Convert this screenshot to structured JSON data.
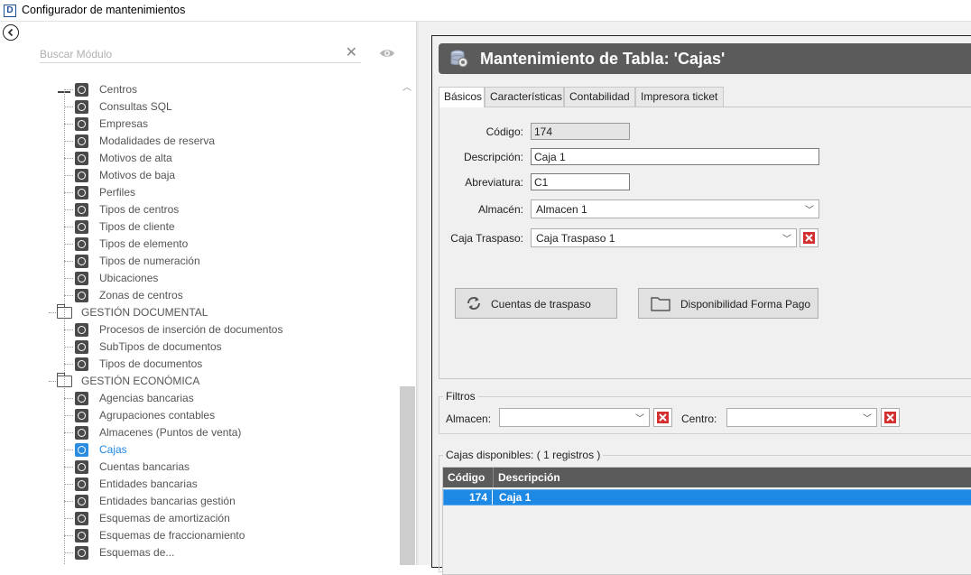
{
  "window": {
    "app_icon": "D",
    "title": "Configurador de mantenimientos"
  },
  "left_panel": {
    "back_icon": "back-arrow-icon",
    "search": {
      "placeholder": "Buscar Módulo",
      "value": "",
      "clear_glyph": "✕"
    },
    "tree": [
      {
        "type": "leaf",
        "label": "Centros"
      },
      {
        "type": "leaf",
        "label": "Consultas SQL"
      },
      {
        "type": "leaf",
        "label": "Empresas"
      },
      {
        "type": "leaf",
        "label": "Modalidades de reserva"
      },
      {
        "type": "leaf",
        "label": "Motivos de alta"
      },
      {
        "type": "leaf",
        "label": "Motivos de baja"
      },
      {
        "type": "leaf",
        "label": "Perfiles"
      },
      {
        "type": "leaf",
        "label": "Tipos de centros"
      },
      {
        "type": "leaf",
        "label": "Tipos de cliente"
      },
      {
        "type": "leaf",
        "label": "Tipos de elemento"
      },
      {
        "type": "leaf",
        "label": "Tipos de numeración"
      },
      {
        "type": "leaf",
        "label": "Ubicaciones"
      },
      {
        "type": "leaf",
        "label": "Zonas de centros"
      },
      {
        "type": "folder",
        "label": "GESTIÓN DOCUMENTAL"
      },
      {
        "type": "leaf",
        "label": "Procesos de inserción de documentos"
      },
      {
        "type": "leaf",
        "label": "SubTipos de documentos"
      },
      {
        "type": "leaf",
        "label": "Tipos de documentos"
      },
      {
        "type": "folder",
        "label": "GESTIÓN ECONÓMICA"
      },
      {
        "type": "leaf",
        "label": "Agencias bancarias"
      },
      {
        "type": "leaf",
        "label": "Agrupaciones contables"
      },
      {
        "type": "leaf",
        "label": "Almacenes (Puntos de venta)"
      },
      {
        "type": "leaf",
        "label": "Cajas",
        "selected": true
      },
      {
        "type": "leaf",
        "label": "Cuentas bancarias"
      },
      {
        "type": "leaf",
        "label": "Entidades bancarias"
      },
      {
        "type": "leaf",
        "label": "Entidades bancarias gestión"
      },
      {
        "type": "leaf",
        "label": "Esquemas de amortización"
      },
      {
        "type": "leaf",
        "label": "Esquemas de fraccionamiento"
      },
      {
        "type": "leaf",
        "label": "Esquemas de..."
      }
    ]
  },
  "main": {
    "header": {
      "title": "Mantenimiento de Tabla: 'Cajas'"
    },
    "tabs": [
      "Básicos",
      "Características",
      "Contabilidad",
      "Impresora ticket"
    ],
    "active_tab": 0,
    "form": {
      "codigo_label": "Código:",
      "codigo_value": "174",
      "descripcion_label": "Descripción:",
      "descripcion_value": "Caja 1",
      "abreviatura_label": "Abreviatura:",
      "abreviatura_value": "C1",
      "almacen_label": "Almacén:",
      "almacen_value": "Almacen 1",
      "caja_traspaso_label": "Caja Traspaso:",
      "caja_traspaso_value": "Caja Traspaso 1"
    },
    "buttons": {
      "cuentas_traspaso": "Cuentas de traspaso",
      "disponibilidad": "Disponibilidad Forma Pago"
    },
    "filters": {
      "title": "Filtros",
      "almacen_label": "Almacen:",
      "almacen_value": "",
      "centro_label": "Centro:",
      "centro_value": ""
    },
    "list": {
      "title": "Cajas disponibles:",
      "count": "( 1 registros )",
      "columns": [
        "Código",
        "Descripción"
      ],
      "rows": [
        {
          "codigo": "174",
          "descripcion": "Caja 1",
          "selected": true
        }
      ]
    },
    "colors": {
      "header_bg": "#5b5b5b",
      "selection": "#1e88e5",
      "delete_red": "#d32f2f"
    }
  }
}
